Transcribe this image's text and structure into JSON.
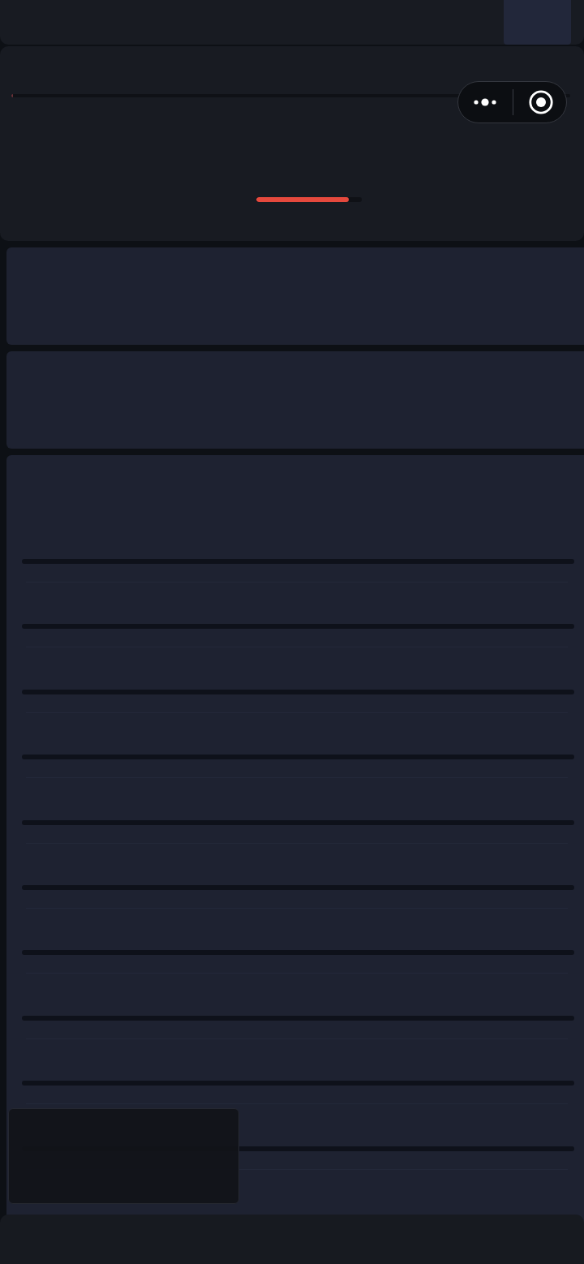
{
  "top_progress": {
    "level": 0.003
  },
  "loading": {
    "level": 0.88
  },
  "cards": [
    {
      "kind": "skeleton"
    },
    {
      "kind": "skeleton"
    }
  ],
  "list": {
    "rows": [
      {
        "kind": "skeleton"
      },
      {
        "kind": "skeleton"
      },
      {
        "kind": "skeleton"
      },
      {
        "kind": "skeleton"
      },
      {
        "kind": "skeleton"
      },
      {
        "kind": "skeleton"
      },
      {
        "kind": "skeleton"
      },
      {
        "kind": "skeleton"
      },
      {
        "kind": "skeleton"
      },
      {
        "kind": "skeleton"
      }
    ]
  }
}
